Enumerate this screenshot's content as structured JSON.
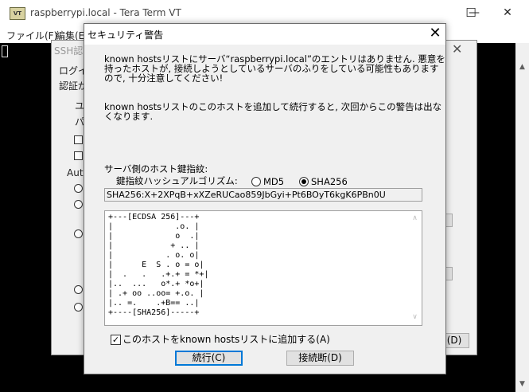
{
  "main_window": {
    "title": "raspberrypi.local - Tera Term VT",
    "icon_label": "VT",
    "controls": {
      "minimize": "—",
      "maximize": "☐",
      "close": "✕"
    },
    "menu": [
      "ファイル(F)",
      "編集(E"
    ]
  },
  "ssh_dialog": {
    "title": "SSH認",
    "close": "✕",
    "fragments": [
      "ログイ",
      "認証が",
      "ユ",
      "パ",
      "Auth"
    ],
    "button_fragment": "(D)"
  },
  "security_dialog": {
    "title": "セキュリティ警告",
    "close": "✕",
    "message1": [
      "known hostsリストにサーバ“raspberrypi.local”のエントリはありません. 悪意を",
      "持ったホストが, 接続しようとしているサーバのふりをしている可能性もあります",
      "ので, 十分注意してください!"
    ],
    "message2": [
      "known hostsリストのこのホストを追加して続行すると, 次回からこの警告は出な",
      "くなります."
    ],
    "fingerprint_label": "サーバ側のホスト鍵指紋:",
    "hash_label": "鍵指紋ハッシュアルゴリズム:",
    "hash_options": [
      {
        "label": "MD5",
        "selected": false
      },
      {
        "label": "SHA256",
        "selected": true
      }
    ],
    "fingerprint": "SHA256:X+2XPqB+xXZeRUCao859JbGyi+Pt6BOyT6kgK6PBn0U",
    "randomart": [
      "+---[ECDSA 256]---+",
      "|             .o. |",
      "|             o  .|",
      "|            + .. |",
      "|           . o. o|",
      "|      E  S . o = o|",
      "|  .   .   .+.+ = *+|",
      "|..  ...   o*.+ *o+|",
      "| .+ oo ..oo= +.o. |",
      "|.. =.    .+B== ..|",
      "+----[SHA256]-----+"
    ],
    "add_checkbox": {
      "label": "このホストをknown hostsリストに追加する(A)",
      "checked": true
    },
    "continue_button": "続行(C)",
    "disconnect_button": "接続断(D)"
  },
  "colors": {
    "focus_border": "#0078d7",
    "dialog_bg": "#f0f0f0",
    "terminal_bg": "#000000"
  }
}
